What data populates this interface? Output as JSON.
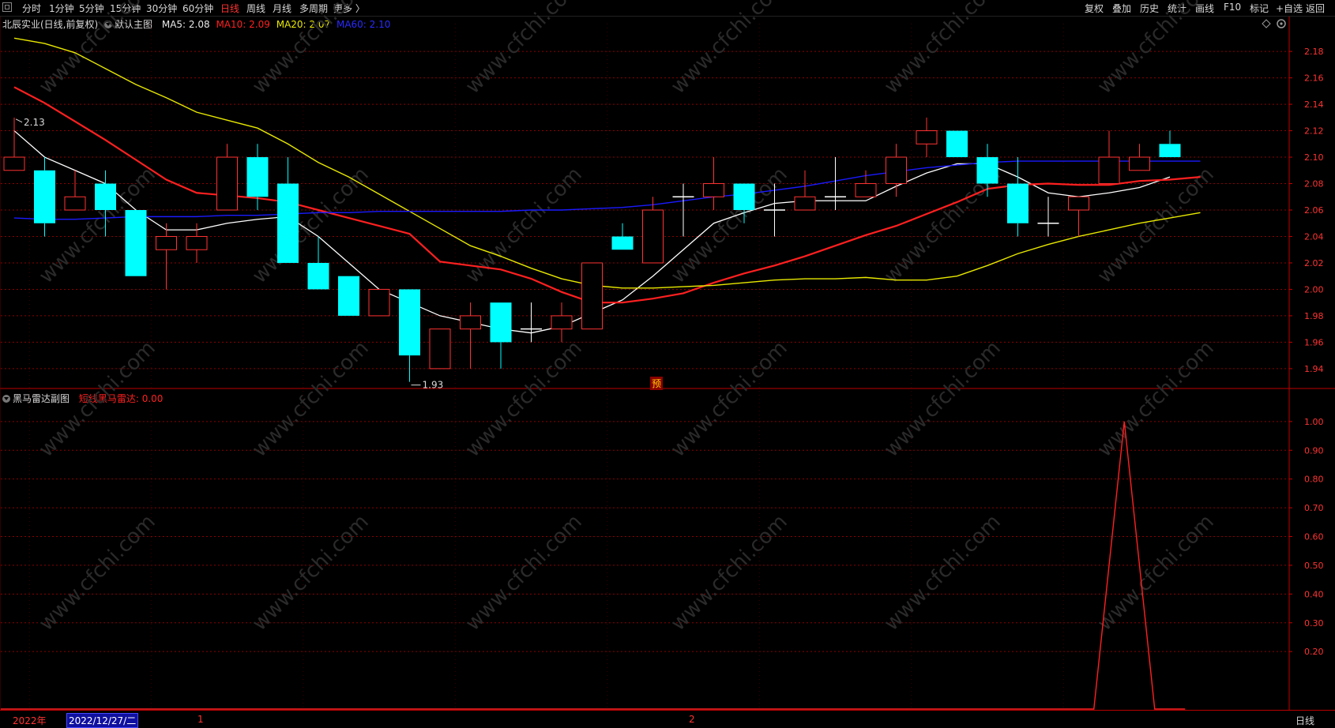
{
  "toolbar": {
    "periods": [
      "分时",
      "1分钟",
      "5分钟",
      "15分钟",
      "30分钟",
      "60分钟",
      "日线",
      "周线",
      "月线",
      "多周期",
      "更多 〉"
    ],
    "active_period": "日线",
    "right": [
      "复权",
      "叠加",
      "历史",
      "统计",
      "画线",
      "F10",
      "标记",
      "+自选",
      "返回"
    ]
  },
  "main_legend": {
    "stock": "北辰实业(日线,前复权)",
    "chart_name": "默认主图",
    "ma5": "MA5: 2.08",
    "ma10": "MA10: 2.09",
    "ma20": "MA20: 2.07",
    "ma60": "MA60: 2.10"
  },
  "sub_legend": {
    "chart_name": "黑马雷达副图",
    "indicator": "短线黑马雷达: 0.00"
  },
  "annotations": {
    "high": "2.13",
    "low": "1.93",
    "yu": "预"
  },
  "date_bar": {
    "year": "2022年",
    "cursor": "2022/12/27/二",
    "m1": "1",
    "m2": "2",
    "period": "日线"
  },
  "icons": {
    "diamond": "diamond-icon",
    "settings": "settings-icon"
  },
  "colors": {
    "up": "#ff3232",
    "down": "#00ffff",
    "ma5": "#ffffff",
    "ma10": "#ff2020",
    "ma20": "#e8e800",
    "ma60": "#1a1aff",
    "grid": "#8b0000"
  },
  "chart_data": [
    {
      "type": "candlestick",
      "title": "北辰实业(日线,前复权)",
      "ylim": [
        1.925,
        2.195
      ],
      "yticks": [
        2.18,
        2.16,
        2.14,
        2.12,
        2.1,
        2.08,
        2.06,
        2.04,
        2.02,
        2.0,
        1.98,
        1.96,
        1.94
      ],
      "candles": [
        {
          "o": 2.09,
          "h": 2.13,
          "l": 2.09,
          "c": 2.1
        },
        {
          "o": 2.09,
          "h": 2.1,
          "l": 2.04,
          "c": 2.05
        },
        {
          "o": 2.06,
          "h": 2.09,
          "l": 2.06,
          "c": 2.07
        },
        {
          "o": 2.08,
          "h": 2.09,
          "l": 2.04,
          "c": 2.06
        },
        {
          "o": 2.06,
          "h": 2.06,
          "l": 2.01,
          "c": 2.01
        },
        {
          "o": 2.03,
          "h": 2.05,
          "l": 2.0,
          "c": 2.04
        },
        {
          "o": 2.03,
          "h": 2.05,
          "l": 2.02,
          "c": 2.04
        },
        {
          "o": 2.06,
          "h": 2.11,
          "l": 2.06,
          "c": 2.1
        },
        {
          "o": 2.1,
          "h": 2.11,
          "l": 2.06,
          "c": 2.07
        },
        {
          "o": 2.08,
          "h": 2.1,
          "l": 2.02,
          "c": 2.02
        },
        {
          "o": 2.02,
          "h": 2.04,
          "l": 2.0,
          "c": 2.0
        },
        {
          "o": 2.01,
          "h": 2.01,
          "l": 1.98,
          "c": 1.98
        },
        {
          "o": 1.98,
          "h": 2.0,
          "l": 1.98,
          "c": 2.0
        },
        {
          "o": 2.0,
          "h": 2.0,
          "l": 1.93,
          "c": 1.95
        },
        {
          "o": 1.94,
          "h": 1.97,
          "l": 1.94,
          "c": 1.97
        },
        {
          "o": 1.97,
          "h": 1.99,
          "l": 1.94,
          "c": 1.98
        },
        {
          "o": 1.99,
          "h": 1.99,
          "l": 1.94,
          "c": 1.96
        },
        {
          "o": 1.97,
          "h": 1.99,
          "l": 1.96,
          "c": 1.97
        },
        {
          "o": 1.97,
          "h": 1.99,
          "l": 1.96,
          "c": 1.98
        },
        {
          "o": 1.97,
          "h": 2.02,
          "l": 1.97,
          "c": 2.02
        },
        {
          "o": 2.04,
          "h": 2.05,
          "l": 2.03,
          "c": 2.03
        },
        {
          "o": 2.02,
          "h": 2.07,
          "l": 2.02,
          "c": 2.06
        },
        {
          "o": 2.07,
          "h": 2.08,
          "l": 2.04,
          "c": 2.07
        },
        {
          "o": 2.07,
          "h": 2.1,
          "l": 2.06,
          "c": 2.08
        },
        {
          "o": 2.08,
          "h": 2.08,
          "l": 2.05,
          "c": 2.06
        },
        {
          "o": 2.06,
          "h": 2.08,
          "l": 2.04,
          "c": 2.06
        },
        {
          "o": 2.06,
          "h": 2.09,
          "l": 2.06,
          "c": 2.07
        },
        {
          "o": 2.07,
          "h": 2.1,
          "l": 2.06,
          "c": 2.07
        },
        {
          "o": 2.07,
          "h": 2.09,
          "l": 2.07,
          "c": 2.08
        },
        {
          "o": 2.08,
          "h": 2.11,
          "l": 2.07,
          "c": 2.1
        },
        {
          "o": 2.11,
          "h": 2.13,
          "l": 2.1,
          "c": 2.12
        },
        {
          "o": 2.12,
          "h": 2.12,
          "l": 2.1,
          "c": 2.1
        },
        {
          "o": 2.1,
          "h": 2.11,
          "l": 2.07,
          "c": 2.08
        },
        {
          "o": 2.08,
          "h": 2.1,
          "l": 2.04,
          "c": 2.05
        },
        {
          "o": 2.05,
          "h": 2.07,
          "l": 2.04,
          "c": 2.05
        },
        {
          "o": 2.06,
          "h": 2.07,
          "l": 2.04,
          "c": 2.07
        },
        {
          "o": 2.08,
          "h": 2.12,
          "l": 2.08,
          "c": 2.1
        },
        {
          "o": 2.09,
          "h": 2.11,
          "l": 2.09,
          "c": 2.1
        },
        {
          "o": 2.11,
          "h": 2.12,
          "l": 2.1,
          "c": 2.1
        }
      ],
      "series": [
        {
          "name": "MA5",
          "values": [
            2.12,
            2.1,
            2.09,
            2.08,
            2.06,
            2.045,
            2.045,
            2.05,
            2.053,
            2.055,
            2.04,
            2.02,
            2.0,
            1.99,
            1.98,
            1.975,
            1.97,
            1.967,
            1.972,
            1.982,
            1.992,
            2.01,
            2.03,
            2.05,
            2.058,
            2.065,
            2.067,
            2.067,
            2.067,
            2.078,
            2.088,
            2.095,
            2.095,
            2.085,
            2.073,
            2.07,
            2.073,
            2.077,
            2.085
          ]
        },
        {
          "name": "MA10",
          "values": [
            2.153,
            2.141,
            2.127,
            2.113,
            2.098,
            2.083,
            2.073,
            2.071,
            2.069,
            2.066,
            2.06,
            2.054,
            2.048,
            2.042,
            2.021,
            2.018,
            2.015,
            2.008,
            1.998,
            1.99,
            1.99,
            1.993,
            1.997,
            2.005,
            2.012,
            2.018,
            2.025,
            2.033,
            2.041,
            2.048,
            2.057,
            2.066,
            2.076,
            2.079,
            2.08,
            2.079,
            2.079,
            2.082,
            2.083,
            2.085
          ]
        },
        {
          "name": "MA20",
          "values": [
            2.19,
            2.186,
            2.179,
            2.167,
            2.155,
            2.145,
            2.134,
            2.128,
            2.122,
            2.11,
            2.096,
            2.085,
            2.072,
            2.059,
            2.046,
            2.033,
            2.025,
            2.016,
            2.008,
            2.003,
            2.001,
            2.001,
            2.002,
            2.003,
            2.005,
            2.007,
            2.008,
            2.008,
            2.009,
            2.007,
            2.007,
            2.01,
            2.018,
            2.027,
            2.034,
            2.04,
            2.045,
            2.05,
            2.054,
            2.058
          ]
        },
        {
          "name": "MA60",
          "values": [
            2.054,
            2.053,
            2.053,
            2.054,
            2.055,
            2.055,
            2.055,
            2.056,
            2.056,
            2.057,
            2.058,
            2.058,
            2.059,
            2.059,
            2.059,
            2.059,
            2.059,
            2.06,
            2.06,
            2.061,
            2.062,
            2.064,
            2.067,
            2.07,
            2.072,
            2.075,
            2.078,
            2.082,
            2.086,
            2.089,
            2.092,
            2.094,
            2.096,
            2.097,
            2.097,
            2.097,
            2.097,
            2.097,
            2.097,
            2.097
          ]
        }
      ]
    },
    {
      "type": "line",
      "title": "黑马雷达副图",
      "ylim": [
        0,
        1.06
      ],
      "yticks": [
        1.0,
        0.9,
        0.8,
        0.7,
        0.6,
        0.5,
        0.4,
        0.3,
        0.2
      ],
      "series": [
        {
          "name": "短线黑马雷达",
          "values": [
            0,
            0,
            0,
            0,
            0,
            0,
            0,
            0,
            0,
            0,
            0,
            0,
            0,
            0,
            0,
            0,
            0,
            0,
            0,
            0,
            0,
            0,
            0,
            0,
            0,
            0,
            0,
            0,
            0,
            0,
            0,
            0,
            0,
            0,
            0,
            0,
            1,
            0,
            0
          ]
        }
      ]
    }
  ]
}
